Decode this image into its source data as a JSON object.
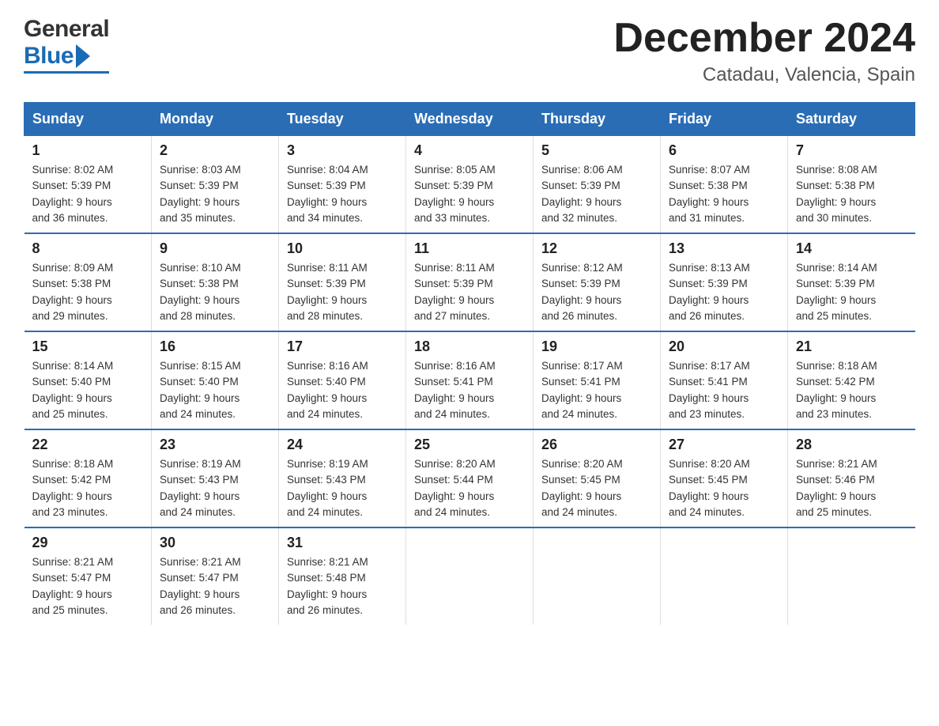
{
  "header": {
    "logo_general": "General",
    "logo_blue": "Blue",
    "title": "December 2024",
    "subtitle": "Catadau, Valencia, Spain"
  },
  "days_of_week": [
    "Sunday",
    "Monday",
    "Tuesday",
    "Wednesday",
    "Thursday",
    "Friday",
    "Saturday"
  ],
  "weeks": [
    [
      {
        "day": "1",
        "sunrise": "8:02 AM",
        "sunset": "5:39 PM",
        "daylight": "9 hours and 36 minutes."
      },
      {
        "day": "2",
        "sunrise": "8:03 AM",
        "sunset": "5:39 PM",
        "daylight": "9 hours and 35 minutes."
      },
      {
        "day": "3",
        "sunrise": "8:04 AM",
        "sunset": "5:39 PM",
        "daylight": "9 hours and 34 minutes."
      },
      {
        "day": "4",
        "sunrise": "8:05 AM",
        "sunset": "5:39 PM",
        "daylight": "9 hours and 33 minutes."
      },
      {
        "day": "5",
        "sunrise": "8:06 AM",
        "sunset": "5:39 PM",
        "daylight": "9 hours and 32 minutes."
      },
      {
        "day": "6",
        "sunrise": "8:07 AM",
        "sunset": "5:38 PM",
        "daylight": "9 hours and 31 minutes."
      },
      {
        "day": "7",
        "sunrise": "8:08 AM",
        "sunset": "5:38 PM",
        "daylight": "9 hours and 30 minutes."
      }
    ],
    [
      {
        "day": "8",
        "sunrise": "8:09 AM",
        "sunset": "5:38 PM",
        "daylight": "9 hours and 29 minutes."
      },
      {
        "day": "9",
        "sunrise": "8:10 AM",
        "sunset": "5:38 PM",
        "daylight": "9 hours and 28 minutes."
      },
      {
        "day": "10",
        "sunrise": "8:11 AM",
        "sunset": "5:39 PM",
        "daylight": "9 hours and 28 minutes."
      },
      {
        "day": "11",
        "sunrise": "8:11 AM",
        "sunset": "5:39 PM",
        "daylight": "9 hours and 27 minutes."
      },
      {
        "day": "12",
        "sunrise": "8:12 AM",
        "sunset": "5:39 PM",
        "daylight": "9 hours and 26 minutes."
      },
      {
        "day": "13",
        "sunrise": "8:13 AM",
        "sunset": "5:39 PM",
        "daylight": "9 hours and 26 minutes."
      },
      {
        "day": "14",
        "sunrise": "8:14 AM",
        "sunset": "5:39 PM",
        "daylight": "9 hours and 25 minutes."
      }
    ],
    [
      {
        "day": "15",
        "sunrise": "8:14 AM",
        "sunset": "5:40 PM",
        "daylight": "9 hours and 25 minutes."
      },
      {
        "day": "16",
        "sunrise": "8:15 AM",
        "sunset": "5:40 PM",
        "daylight": "9 hours and 24 minutes."
      },
      {
        "day": "17",
        "sunrise": "8:16 AM",
        "sunset": "5:40 PM",
        "daylight": "9 hours and 24 minutes."
      },
      {
        "day": "18",
        "sunrise": "8:16 AM",
        "sunset": "5:41 PM",
        "daylight": "9 hours and 24 minutes."
      },
      {
        "day": "19",
        "sunrise": "8:17 AM",
        "sunset": "5:41 PM",
        "daylight": "9 hours and 24 minutes."
      },
      {
        "day": "20",
        "sunrise": "8:17 AM",
        "sunset": "5:41 PM",
        "daylight": "9 hours and 23 minutes."
      },
      {
        "day": "21",
        "sunrise": "8:18 AM",
        "sunset": "5:42 PM",
        "daylight": "9 hours and 23 minutes."
      }
    ],
    [
      {
        "day": "22",
        "sunrise": "8:18 AM",
        "sunset": "5:42 PM",
        "daylight": "9 hours and 23 minutes."
      },
      {
        "day": "23",
        "sunrise": "8:19 AM",
        "sunset": "5:43 PM",
        "daylight": "9 hours and 24 minutes."
      },
      {
        "day": "24",
        "sunrise": "8:19 AM",
        "sunset": "5:43 PM",
        "daylight": "9 hours and 24 minutes."
      },
      {
        "day": "25",
        "sunrise": "8:20 AM",
        "sunset": "5:44 PM",
        "daylight": "9 hours and 24 minutes."
      },
      {
        "day": "26",
        "sunrise": "8:20 AM",
        "sunset": "5:45 PM",
        "daylight": "9 hours and 24 minutes."
      },
      {
        "day": "27",
        "sunrise": "8:20 AM",
        "sunset": "5:45 PM",
        "daylight": "9 hours and 24 minutes."
      },
      {
        "day": "28",
        "sunrise": "8:21 AM",
        "sunset": "5:46 PM",
        "daylight": "9 hours and 25 minutes."
      }
    ],
    [
      {
        "day": "29",
        "sunrise": "8:21 AM",
        "sunset": "5:47 PM",
        "daylight": "9 hours and 25 minutes."
      },
      {
        "day": "30",
        "sunrise": "8:21 AM",
        "sunset": "5:47 PM",
        "daylight": "9 hours and 26 minutes."
      },
      {
        "day": "31",
        "sunrise": "8:21 AM",
        "sunset": "5:48 PM",
        "daylight": "9 hours and 26 minutes."
      },
      null,
      null,
      null,
      null
    ]
  ],
  "labels": {
    "sunrise_prefix": "Sunrise: ",
    "sunset_prefix": "Sunset: ",
    "daylight_prefix": "Daylight: "
  }
}
